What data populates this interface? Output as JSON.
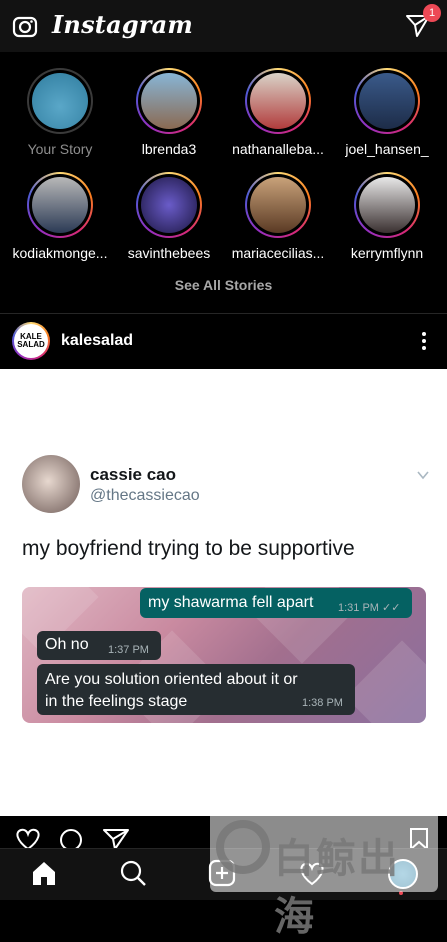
{
  "header": {
    "brand": "Instagram",
    "camera_icon": "camera-icon",
    "direct_icon": "paper-plane-icon",
    "badge_count": "1"
  },
  "stories": [
    {
      "name": "Your Story",
      "own": true
    },
    {
      "name": "lbrenda3"
    },
    {
      "name": "nathanalleba..."
    },
    {
      "name": "joel_hansen_"
    },
    {
      "name": "kodiakmonge..."
    },
    {
      "name": "savinthebees"
    },
    {
      "name": "mariacecilias..."
    },
    {
      "name": "kerrymflynn"
    }
  ],
  "see_all": "See All Stories",
  "post": {
    "username": "kalesalad",
    "avatar_text": "KALE SALAD",
    "tweet": {
      "name": "cassie cao",
      "handle": "@thecassiecao",
      "text": "my boyfriend trying to be supportive",
      "messages": [
        {
          "text": "my shawarma fell apart",
          "time": "1:31 PM ✓✓",
          "dir": "out"
        },
        {
          "text": "Oh no",
          "time": "1:37 PM",
          "dir": "in"
        },
        {
          "text": "Are you solution oriented about it or in the feelings stage",
          "time": "1:38 PM",
          "dir": "in"
        }
      ]
    }
  },
  "watermark": "白鲸出海",
  "colors": {
    "badge": "#ed4956",
    "out_bubble": "#056162",
    "in_bubble": "#262d31",
    "story_ring": "#d62976"
  }
}
